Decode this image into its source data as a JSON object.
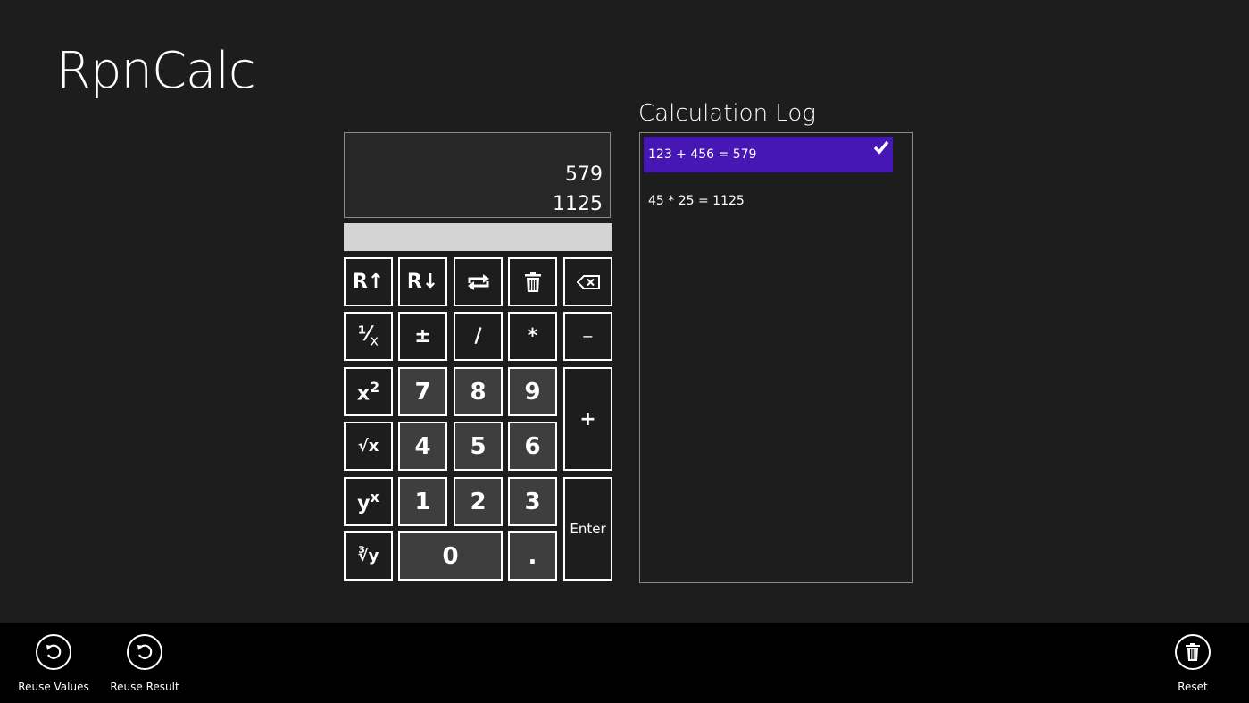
{
  "app": {
    "title": "RpnCalc"
  },
  "display": {
    "stack": [
      "579",
      "1125"
    ],
    "entry_value": ""
  },
  "keypad": {
    "roll_up": "R↑",
    "roll_down": "R↓",
    "swap_icon": "swap-icon",
    "clear_icon": "trash-icon",
    "backspace_icon": "backspace-icon",
    "reciprocal": "⅟",
    "reciprocal_x": "x",
    "plus_minus": "±",
    "divide": "/",
    "multiply": "*",
    "subtract": "−",
    "square_base": "x",
    "square_exp": "2",
    "sqrt": "√x",
    "power_base": "y",
    "power_exp": "x",
    "root": "∛y",
    "add": "+",
    "enter": "Enter",
    "dot": ".",
    "d0": "0",
    "d1": "1",
    "d2": "2",
    "d3": "3",
    "d4": "4",
    "d5": "5",
    "d6": "6",
    "d7": "7",
    "d8": "8",
    "d9": "9"
  },
  "log": {
    "title": "Calculation Log",
    "items": [
      {
        "text": "123 + 456 = 579",
        "selected": true
      },
      {
        "text": "45 * 25 = 1125",
        "selected": false
      }
    ]
  },
  "appbar": {
    "reuse_values": "Reuse Values",
    "reuse_result": "Reuse Result",
    "reset": "Reset"
  },
  "colors": {
    "background": "#1d1d1d",
    "appbar": "#000000",
    "accent": "#4617b4",
    "number_key": "#3e3e3e",
    "entry_field": "#d4d4d4"
  }
}
